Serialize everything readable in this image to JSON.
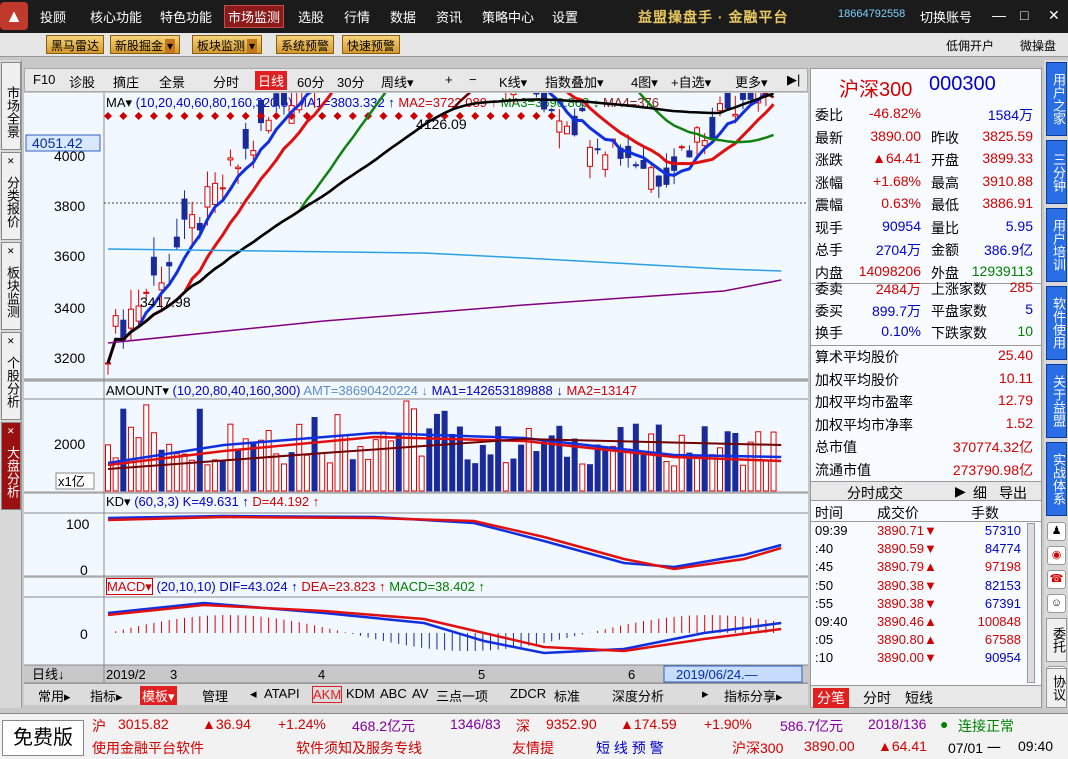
{
  "topbar": {
    "logo": "▲",
    "menu": [
      "投顾",
      "核心功能",
      "特色功能",
      "市场监测",
      "选股",
      "行情",
      "数据",
      "资讯",
      "策略中心",
      "设置"
    ],
    "active": "市场监测",
    "brand": "益盟操盘手 · 金融平台",
    "phone": "18664792558",
    "switch_account": "切换账号",
    "min": "—",
    "max": "□",
    "close": "✕"
  },
  "toolbar": {
    "buttons": [
      "黑马雷达",
      "新股掘金",
      "板块监测",
      "系统预警",
      "快速预警"
    ],
    "right": [
      "低佣开户",
      "微操盘"
    ]
  },
  "lefttabs": [
    "市场全景",
    "分类报价",
    "板块监测",
    "个股分析",
    "大盘分析"
  ],
  "righttabs": [
    "用户之家",
    "三分钟",
    "用户培训",
    "软件使用",
    "关于益盟",
    "实战体系"
  ],
  "righticons": [
    "♟",
    "◉",
    "☎",
    "☺",
    "◐"
  ],
  "righttexts": [
    "委托",
    "协议"
  ],
  "chartbar": {
    "items": [
      "F10",
      "诊股",
      "摘庄",
      "全景",
      "分时",
      "日线",
      "60分",
      "30分",
      "周线▾",
      "+",
      "−",
      "K线▾",
      "指数叠加▾",
      "4图▾",
      "+自选▾",
      "更多▾",
      "▶|"
    ],
    "active": "日线"
  },
  "main": {
    "ma_label": "MA▾",
    "ma_params": "(10,20,40,60,80,160,320,5)",
    "ma1": "MA1=3803.332 ↑",
    "ma2": "MA2=3722.089 ↑",
    "ma3": "MA3=3690.863 ↓",
    "ma4": "MA4=376",
    "price_tag": "4051.42",
    "yticks": [
      "4000",
      "3800",
      "3600",
      "3400",
      "3200"
    ],
    "high_note": "4126.09",
    "low_note": "3417.98"
  },
  "amount": {
    "label": "AMOUNT▾",
    "params": "(10,20,80,40,160,300)",
    "amt": "AMT=38690420224 ↓",
    "ma1": "MA1=142653189888 ↓",
    "ma2": "MA2=13147",
    "ytick": "2000",
    "unit": "x1亿"
  },
  "kd": {
    "label": "KD▾",
    "params": "(60,3,3)",
    "k": "K=49.631 ↑",
    "d": "D=44.192 ↑",
    "yticks": [
      "100",
      "0"
    ]
  },
  "macd": {
    "label": "MACD▾",
    "params": "(20,10,10)",
    "dif": "DIF=43.024 ↑",
    "dea": "DEA=23.823 ↑",
    "macd": "MACD=38.402 ↑",
    "ytick": "0"
  },
  "xaxis": {
    "period": "日线↓",
    "labels": [
      "2019/2",
      "3",
      "4",
      "5",
      "6"
    ],
    "cursor_date": "2019/06/24.—"
  },
  "bottomtabs": [
    "常用▸",
    "指标▸",
    "模板▾",
    "管理",
    "◂",
    "ATAPI",
    "AKM",
    "KDM",
    "ABC",
    "AV",
    "三点一项",
    "ZDCR",
    "标准",
    "深度分析",
    "▸",
    "指标分享▸"
  ],
  "quote": {
    "name": "沪深300",
    "code": "000300",
    "rows": [
      [
        "委比",
        "-46.82%",
        "",
        "1584万"
      ],
      [
        "最新",
        "3890.00",
        "昨收",
        "3825.59"
      ],
      [
        "涨跌",
        "▲64.41",
        "开盘",
        "3899.33"
      ],
      [
        "涨幅",
        "+1.68%",
        "最高",
        "3910.88"
      ],
      [
        "震幅",
        "0.63%",
        "最低",
        "3886.91"
      ],
      [
        "现手",
        "90954",
        "量比",
        "5.95"
      ],
      [
        "总手",
        "2704万",
        "金额",
        "386.9亿"
      ],
      [
        "内盘",
        "14098206",
        "外盘",
        "12939113"
      ]
    ],
    "rows2": [
      [
        "委卖",
        "2484万",
        "上涨家数",
        "285"
      ],
      [
        "委买",
        "899.7万",
        "平盘家数",
        "5"
      ],
      [
        "换手",
        "0.10%",
        "下跌家数",
        "10"
      ]
    ],
    "stats": [
      [
        "算术平均股价",
        "25.40"
      ],
      [
        "加权平均股价",
        "10.11"
      ],
      [
        "加权平均市盈率",
        "12.79"
      ],
      [
        "加权平均市净率",
        "1.52"
      ],
      [
        "总市值",
        "370774.32亿"
      ],
      [
        "流通市值",
        "273790.98亿"
      ]
    ],
    "trades_title": "分时成交",
    "trades_btns": [
      "▶",
      "细",
      "导出"
    ],
    "trade_headers": [
      "时间",
      "成交价",
      "手数"
    ],
    "trades": [
      [
        "09:39",
        "3890.71▼",
        "57310"
      ],
      [
        ":40",
        "3890.59▼",
        "84774"
      ],
      [
        ":45",
        "3890.79▲",
        "97198"
      ],
      [
        ":50",
        "3890.38▼",
        "82153"
      ],
      [
        ":55",
        "3890.38▼",
        "67391"
      ],
      [
        "09:40",
        "3890.46▲",
        "100848"
      ],
      [
        ":05",
        "3890.80▲",
        "67588"
      ],
      [
        ":10",
        "3890.00▼",
        "90954"
      ]
    ],
    "tabs": [
      "分笔",
      "分时",
      "短线"
    ]
  },
  "status": {
    "version": "免费版",
    "sh_name": "沪",
    "sh_val": "3015.82",
    "sh_chg": "▲36.94",
    "sh_pct": "+1.24%",
    "sh_amt": "468.2亿元",
    "sh_ud": "1346/83",
    "sz_name": "深",
    "sz_val": "9352.90",
    "sz_chg": "▲174.59",
    "sz_pct": "+1.90%",
    "sz_amt": "586.7亿元",
    "sz_ud": "2018/136",
    "conn": "连接正常",
    "links": [
      "使用金融平台软件",
      "软件须知及服务专线",
      "友情提",
      "短 线 预 警"
    ],
    "tick_name": "沪深300",
    "tick_val": "3890.00",
    "tick_chg": "▲64.41",
    "date": "07/01 一",
    "time": "09:40"
  }
}
